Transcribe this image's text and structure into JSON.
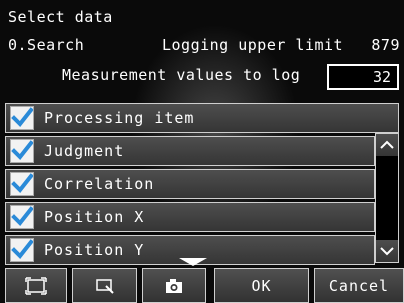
{
  "header": {
    "title": "Select data",
    "item_name": "0.Search",
    "logging_upper_limit_label": "Logging upper limit",
    "logging_upper_limit_value": "879",
    "measurement_values_label": "Measurement values to log",
    "measurement_values_count": "32"
  },
  "list": {
    "items": [
      {
        "label": "Processing item",
        "checked": true
      },
      {
        "label": "Judgment",
        "checked": true
      },
      {
        "label": "Correlation",
        "checked": true
      },
      {
        "label": "Position X",
        "checked": true
      },
      {
        "label": "Position Y",
        "checked": true
      }
    ]
  },
  "toolbar": {
    "buttons": [
      {
        "icon": "frame-icon"
      },
      {
        "icon": "zoom-icon"
      },
      {
        "icon": "camera-icon"
      },
      {
        "label": "OK"
      },
      {
        "label": "Cancel"
      }
    ]
  },
  "colors": {
    "checkbox_check": "#2a8ad8",
    "row_border": "#cfcfcf",
    "background": "#0a0a0a"
  }
}
